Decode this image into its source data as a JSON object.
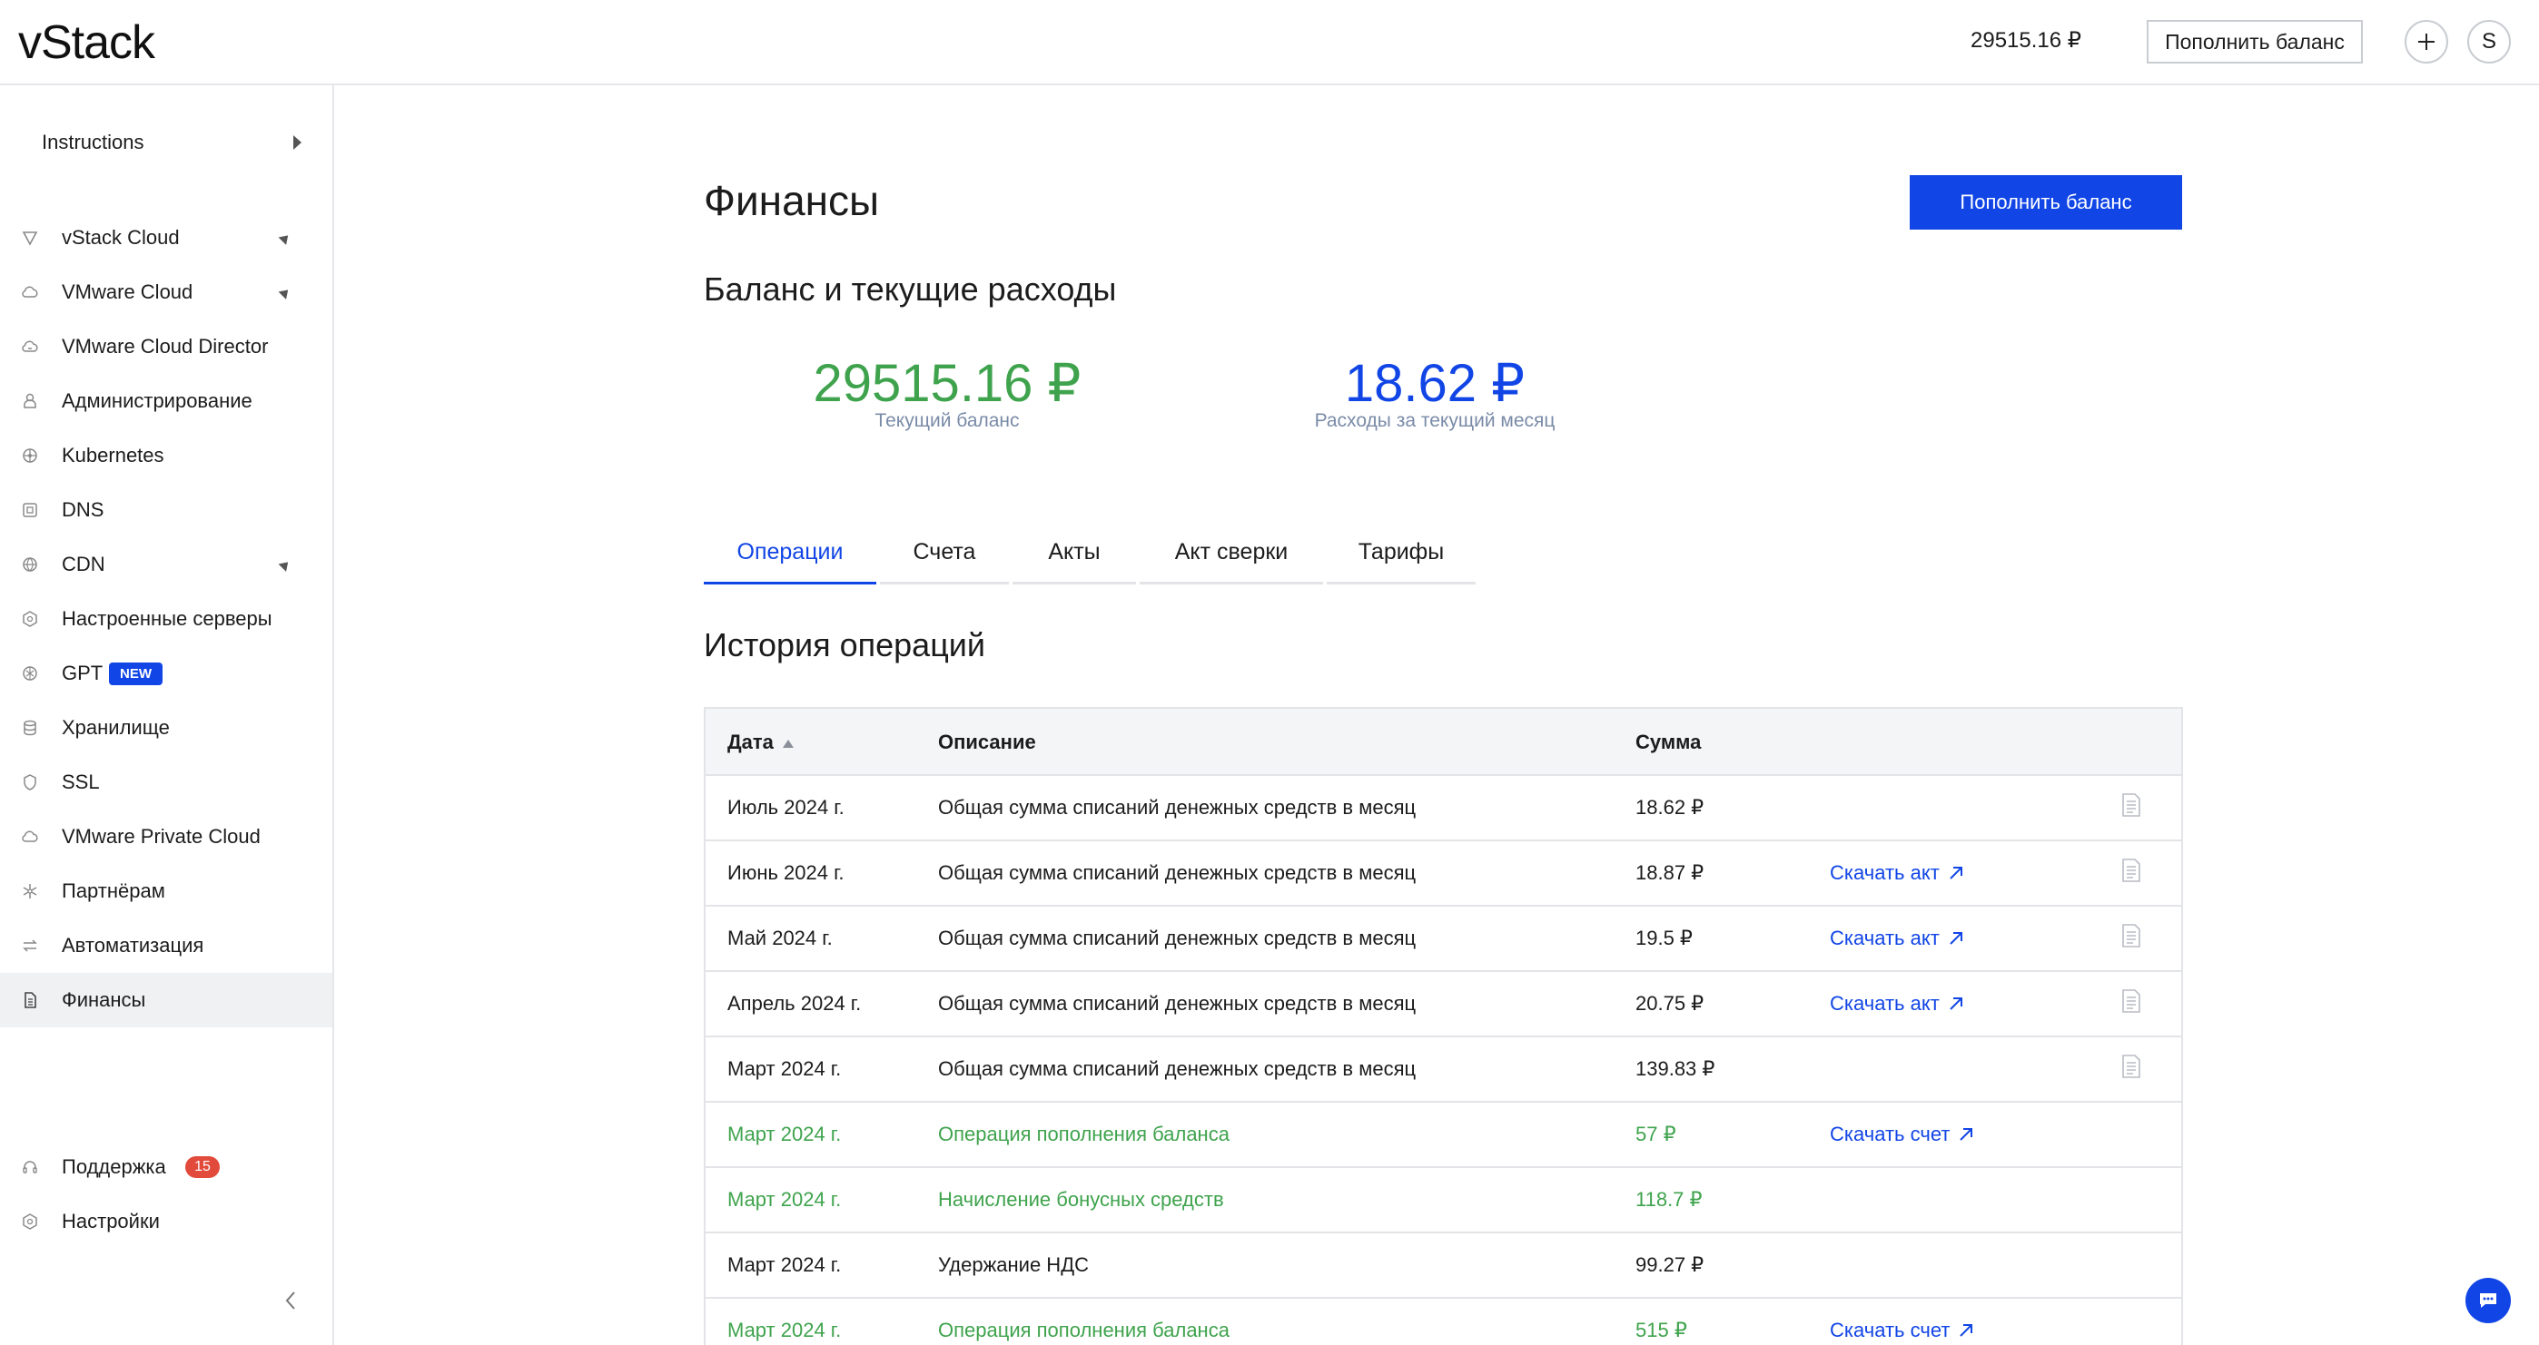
{
  "header": {
    "logo_text": "vStack",
    "balance": "29515.16 ₽",
    "topup_label": "Пополнить баланс",
    "plus_icon": "plus-icon",
    "avatar_letter": "S"
  },
  "sidebar": {
    "instructions": "Instructions",
    "items": [
      {
        "label": "vStack Cloud",
        "icon": "vstack-icon",
        "expandable": true
      },
      {
        "label": "VMware Cloud",
        "icon": "cloud-icon",
        "expandable": true
      },
      {
        "label": "VMware Cloud Director",
        "icon": "cloud-director-icon",
        "expandable": false
      },
      {
        "label": "Администрирование",
        "icon": "user-icon",
        "expandable": false
      },
      {
        "label": "Kubernetes",
        "icon": "kubernetes-icon",
        "expandable": false
      },
      {
        "label": "DNS",
        "icon": "dns-icon",
        "expandable": false
      },
      {
        "label": "CDN",
        "icon": "globe-icon",
        "expandable": true
      },
      {
        "label": "Настроенные серверы",
        "icon": "server-icon",
        "expandable": false
      },
      {
        "label": "GPT",
        "icon": "gpt-icon",
        "expandable": false,
        "badge": "NEW"
      },
      {
        "label": "Хранилище",
        "icon": "database-icon",
        "expandable": false
      },
      {
        "label": "SSL",
        "icon": "shield-icon",
        "expandable": false
      },
      {
        "label": "VMware Private Cloud",
        "icon": "private-cloud-icon",
        "expandable": false
      },
      {
        "label": "Партнёрам",
        "icon": "partners-icon",
        "expandable": false
      },
      {
        "label": "Автоматизация",
        "icon": "automation-icon",
        "expandable": false
      },
      {
        "label": "Финансы",
        "icon": "document-icon",
        "expandable": false,
        "active": true
      }
    ],
    "support": {
      "label": "Поддержка",
      "count": "15"
    },
    "settings": {
      "label": "Настройки"
    }
  },
  "main": {
    "title": "Финансы",
    "topup_label": "Пополнить баланс",
    "section_title": "Баланс и текущие расходы",
    "balance_value": "29515.16 ₽",
    "balance_caption": "Текущий баланс",
    "spend_value": "18.62 ₽",
    "spend_caption": "Расходы за текущий месяц",
    "tabs": [
      "Операции",
      "Счета",
      "Акты",
      "Акт сверки",
      "Тарифы"
    ],
    "active_tab": "Операции",
    "history_title": "История операций",
    "table": {
      "headers": {
        "date": "Дата",
        "description": "Описание",
        "sum": "Сумма"
      },
      "rows": [
        {
          "date": "Июль 2024 г.",
          "description": "Общая сумма списаний денежных средств в месяц",
          "sum": "18.62 ₽",
          "link": "",
          "doc": true,
          "green": false
        },
        {
          "date": "Июнь 2024 г.",
          "description": "Общая сумма списаний денежных средств в месяц",
          "sum": "18.87 ₽",
          "link": "Скачать акт",
          "doc": true,
          "green": false
        },
        {
          "date": "Май 2024 г.",
          "description": "Общая сумма списаний денежных средств в месяц",
          "sum": "19.5 ₽",
          "link": "Скачать акт",
          "doc": true,
          "green": false
        },
        {
          "date": "Апрель 2024 г.",
          "description": "Общая сумма списаний денежных средств в месяц",
          "sum": "20.75 ₽",
          "link": "Скачать акт",
          "doc": true,
          "green": false
        },
        {
          "date": "Март 2024 г.",
          "description": "Общая сумма списаний денежных средств в месяц",
          "sum": "139.83 ₽",
          "link": "",
          "doc": true,
          "green": false
        },
        {
          "date": "Март 2024 г.",
          "description": "Операция пополнения баланса",
          "sum": "57 ₽",
          "link": "Скачать счет",
          "doc": false,
          "green": true
        },
        {
          "date": "Март 2024 г.",
          "description": "Начисление бонусных средств",
          "sum": "118.7 ₽",
          "link": "",
          "doc": false,
          "green": true
        },
        {
          "date": "Март 2024 г.",
          "description": "Удержание НДС",
          "sum": "99.27 ₽",
          "link": "",
          "doc": false,
          "green": false
        },
        {
          "date": "Март 2024 г.",
          "description": "Операция пополнения баланса",
          "sum": "515 ₽",
          "link": "Скачать счет",
          "doc": false,
          "green": true
        }
      ]
    }
  },
  "colors": {
    "accent": "#1145e6",
    "positive": "#3fa34d",
    "badge_red": "#e24a3b"
  }
}
